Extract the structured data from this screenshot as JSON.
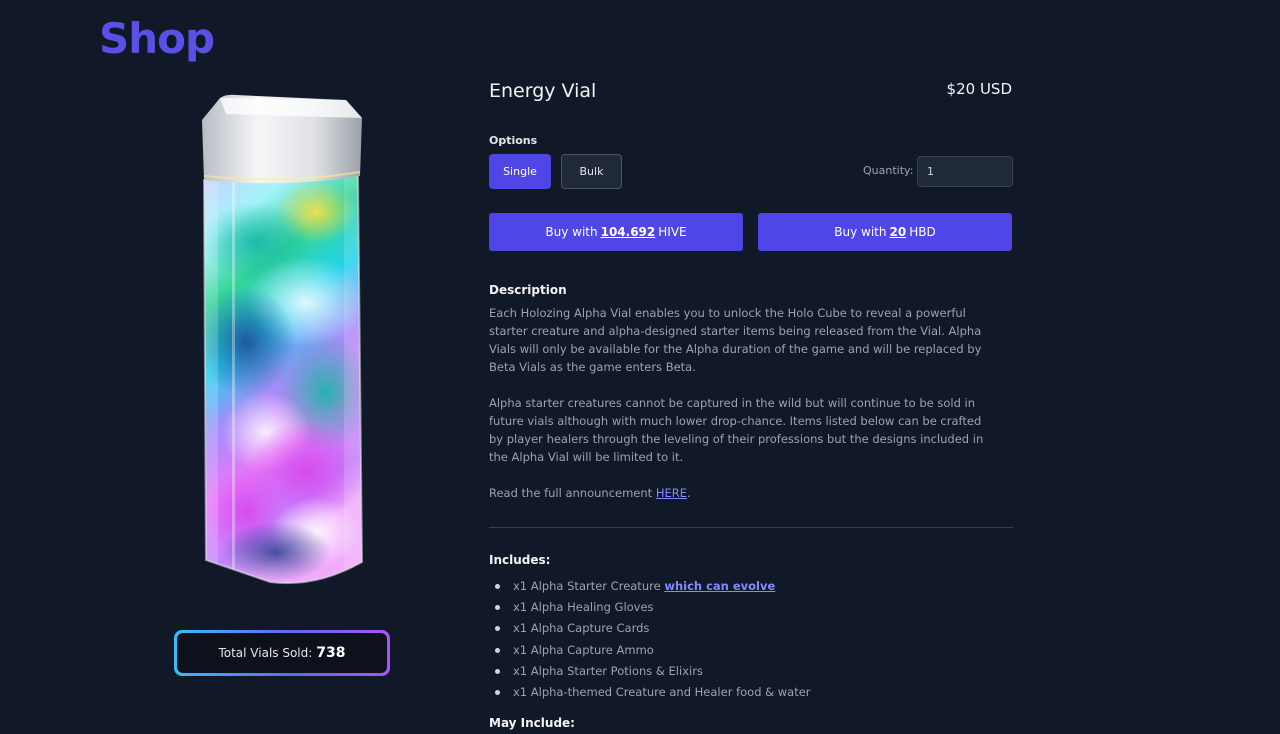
{
  "page": {
    "title": "Shop"
  },
  "product": {
    "name": "Energy Vial",
    "price": "$20 USD",
    "image_alt": "vial-image"
  },
  "sold": {
    "label": "Total Vials Sold:",
    "count": "738"
  },
  "options": {
    "label": "Options",
    "items": [
      "Single",
      "Bulk"
    ],
    "selected": "Single"
  },
  "quantity": {
    "label": "Quantity:",
    "value": "1"
  },
  "buy": {
    "hive": {
      "prefix": "Buy with",
      "amount": "104.692",
      "currency": "HIVE"
    },
    "hbd": {
      "prefix": "Buy with",
      "amount": "20",
      "currency": "HBD"
    }
  },
  "description": {
    "heading": "Description",
    "p1": "Each Holozing Alpha Vial enables you to unlock the Holo Cube to reveal a powerful starter creature and alpha-designed starter items being released from the Vial. Alpha Vials will only be available for the Alpha duration of the game and will be replaced by Beta Vials as the game enters Beta.",
    "p2": "Alpha starter creatures cannot be captured in the wild but will continue to be sold in future vials although with much lower drop-chance. Items listed below can be crafted by player healers through the leveling of their professions but the designs included in the Alpha Vial will be limited to it.",
    "p3_prefix": "Read the full announcement",
    "p3_link": "HERE",
    "p3_suffix": "."
  },
  "includes": {
    "heading": "Includes:",
    "item0_prefix": "x1 Alpha Starter Creature",
    "item0_link": "which can evolve",
    "items": [
      "x1 Alpha Healing Gloves",
      "x1 Alpha Capture Cards",
      "x1 Alpha Capture Ammo",
      "x1 Alpha Starter Potions & Elixirs",
      "x1 Alpha-themed Creature and Healer food & water"
    ]
  },
  "may_include": {
    "heading": "May Include:"
  },
  "colors": {
    "background": "#111827",
    "accent": "#4f46e5",
    "title": "#5b50e6",
    "link": "#818cf8"
  }
}
